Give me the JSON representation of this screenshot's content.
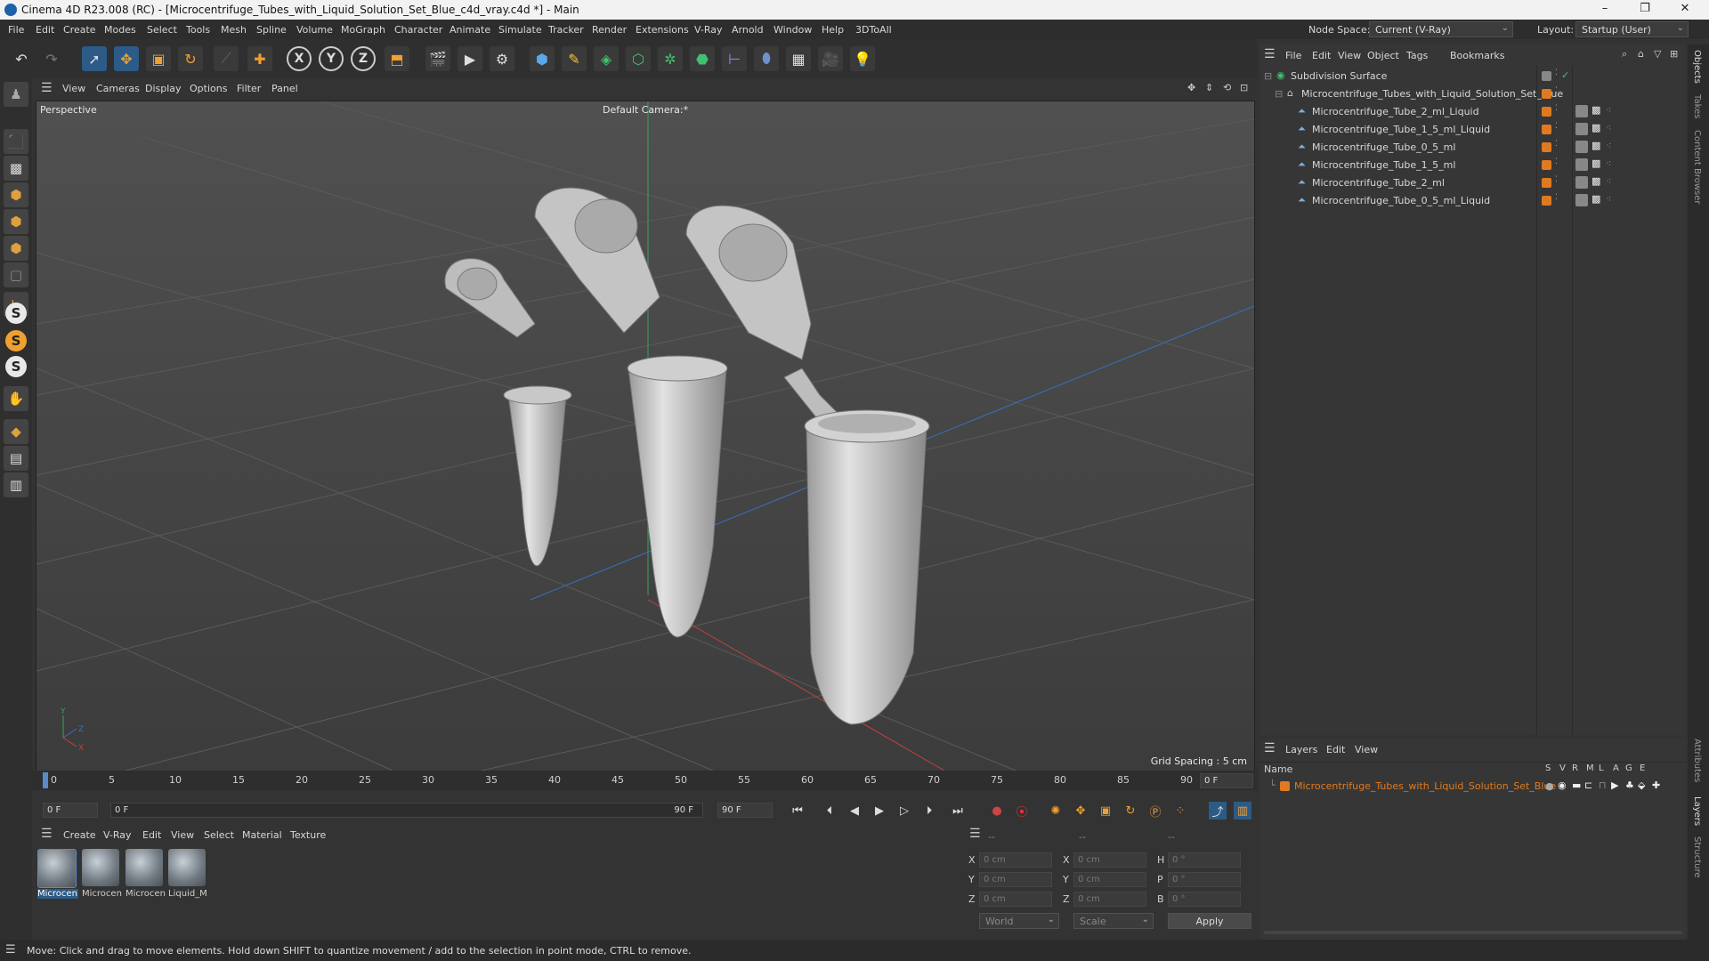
{
  "window": {
    "title": "Cinema 4D R23.008 (RC) - [Microcentrifuge_Tubes_with_Liquid_Solution_Set_Blue_c4d_vray.c4d *] - Main",
    "controls": [
      "–",
      "❐",
      "✕"
    ]
  },
  "menubar": {
    "items": [
      "File",
      "Edit",
      "Create",
      "Modes",
      "Select",
      "Tools",
      "Mesh",
      "Spline",
      "Volume",
      "MoGraph",
      "Character",
      "Animate",
      "Simulate",
      "Tracker",
      "Render",
      "Extensions",
      "V-Ray",
      "Arnold",
      "Window",
      "Help",
      "3DToAll"
    ],
    "node_space_label": "Node Space:",
    "node_space_value": "Current (V-Ray)",
    "layout_label": "Layout:",
    "layout_value": "Startup (User)"
  },
  "viewport": {
    "menu": [
      "View",
      "Cameras",
      "Display",
      "Options",
      "Filter",
      "Panel"
    ],
    "view_name": "Perspective",
    "camera_name": "Default Camera",
    "camera_suffix": ":*",
    "grid_spacing": "Grid Spacing : 5 cm",
    "axis_labels": {
      "y": "Y",
      "z": "Z",
      "x": "X"
    }
  },
  "timeline": {
    "ticks": [
      "0",
      "5",
      "10",
      "15",
      "20",
      "25",
      "30",
      "35",
      "40",
      "45",
      "50",
      "55",
      "60",
      "65",
      "70",
      "75",
      "80",
      "85",
      "90"
    ],
    "current_frame_display": "0 F",
    "start_frame": "0 F",
    "range_start": "0 F",
    "range_end": "90 F",
    "end_frame": "90 F"
  },
  "object_manager": {
    "menu": [
      "File",
      "Edit",
      "View",
      "Object",
      "Tags",
      "Bookmarks"
    ],
    "objects": [
      {
        "name": "Subdivision Surface",
        "level": 0
      },
      {
        "name": "Microcentrifuge_Tubes_with_Liquid_Solution_Set_Blue",
        "level": 1
      },
      {
        "name": "Microcentrifuge_Tube_2_ml_Liquid",
        "level": 2
      },
      {
        "name": "Microcentrifuge_Tube_1_5_ml_Liquid",
        "level": 2
      },
      {
        "name": "Microcentrifuge_Tube_0_5_ml",
        "level": 2
      },
      {
        "name": "Microcentrifuge_Tube_1_5_ml",
        "level": 2
      },
      {
        "name": "Microcentrifuge_Tube_2_ml",
        "level": 2
      },
      {
        "name": "Microcentrifuge_Tube_0_5_ml_Liquid",
        "level": 2
      }
    ]
  },
  "layer_manager": {
    "menu": [
      "Layers",
      "Edit",
      "View"
    ],
    "col_name": "Name",
    "col_flags": [
      "S",
      "V",
      "R",
      "M",
      "L",
      "A",
      "G",
      "E"
    ],
    "layers": [
      {
        "name": "Microcentrifuge_Tubes_with_Liquid_Solution_Set_Blue",
        "color": "#e07a20"
      }
    ]
  },
  "material_manager": {
    "menu": [
      "Create",
      "V-Ray",
      "Edit",
      "View",
      "Select",
      "Material",
      "Texture"
    ],
    "materials": [
      "Microcen",
      "Microcen",
      "Microcen",
      "Liquid_M"
    ]
  },
  "coordinates": {
    "headers": [
      "--",
      "--",
      "--"
    ],
    "rows": [
      {
        "a": "X",
        "av": "0 cm",
        "b": "X",
        "bv": "0 cm",
        "c": "H",
        "cv": "0 °"
      },
      {
        "a": "Y",
        "av": "0 cm",
        "b": "Y",
        "bv": "0 cm",
        "c": "P",
        "cv": "0 °"
      },
      {
        "a": "Z",
        "av": "0 cm",
        "b": "Z",
        "bv": "0 cm",
        "c": "B",
        "cv": "0 °"
      }
    ],
    "space": "World",
    "mode": "Scale",
    "apply": "Apply"
  },
  "right_tabs": [
    "Objects",
    "Takes",
    "Content Browser",
    "Attributes",
    "Layers",
    "Structure"
  ],
  "status": "Move: Click and drag to move elements. Hold down SHIFT to quantize movement / add to the selection in point mode, CTRL to remove.",
  "colors": {
    "accent": "#2b5b86",
    "layer_orange": "#e07a20",
    "x_axis": "#c04040",
    "z_axis": "#3a6fc0",
    "y_axis": "#3aa060"
  }
}
